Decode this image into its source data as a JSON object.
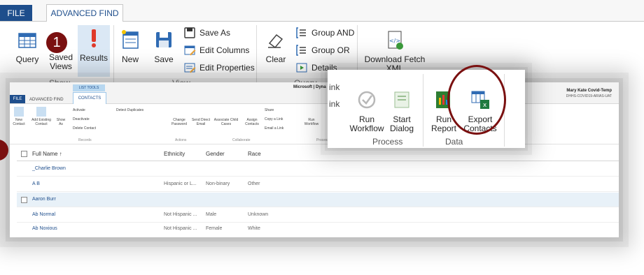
{
  "ribbon": {
    "tabs": {
      "file": "FILE",
      "advanced_find": "ADVANCED FIND"
    },
    "groups": {
      "show": "Show",
      "view": "View",
      "query": "Query"
    },
    "buttons": {
      "query": "Query",
      "saved_views": "Saved Views",
      "results": "Results",
      "new": "New",
      "save": "Save",
      "save_as": "Save As",
      "edit_columns": "Edit Columns",
      "edit_properties": "Edit Properties",
      "clear": "Clear",
      "group_and": "Group AND",
      "group_or": "Group OR",
      "details": "Details",
      "download_fetch_xml": "Download Fetch XML"
    }
  },
  "annotation": {
    "step_number": "1"
  },
  "contacts_screen": {
    "tabs": {
      "file": "FILE",
      "advanced_find": "ADVANCED FIND",
      "list_tools": "LIST TOOLS",
      "contacts": "CONTACTS"
    },
    "brand": "Microsoft | Dyna",
    "user": {
      "name": "Mary Kate Covid-Temp",
      "org": "DHHS-COVID19-ARIAS-UAT"
    },
    "commands": {
      "new_contact": "New Contact",
      "add_existing_contact": "Add Existing Contact",
      "show_as": "Show As",
      "activate": "Activate",
      "deactivate": "Deactivate",
      "delete_contact": "Delete Contact",
      "detect_duplicates": "Detect Duplicates",
      "change_password": "Change Password",
      "send_direct_email": "Send Direct Email",
      "associate_child_cases": "Associate Child Cases",
      "assign_contacts": "Assign Contacts",
      "share": "Share",
      "copy_a_link": "Copy a Link",
      "email_a_link": "Email a Link",
      "run_workflow": "Run Workflow"
    },
    "groups": {
      "records": "Records",
      "actions": "Actions",
      "collaborate": "Collaborate",
      "process": "Process"
    },
    "grid": {
      "columns": [
        "Full Name ↑",
        "Ethnicity",
        "Gender",
        "Race"
      ],
      "rows": [
        {
          "name": "_Charlie Brown",
          "ethnicity": "",
          "gender": "",
          "race": ""
        },
        {
          "name": "A B",
          "ethnicity": "Hispanic or L...",
          "gender": "Non-binary",
          "race": "Other"
        },
        {
          "name": "Aaron Burr",
          "ethnicity": "",
          "gender": "",
          "race": ""
        },
        {
          "name": "Ab Normal",
          "ethnicity": "Not Hispanic ...",
          "gender": "Male",
          "race": "Unknown"
        },
        {
          "name": "Ab Noxious",
          "ethnicity": "Not Hispanic ...",
          "gender": "Female",
          "race": "White"
        }
      ]
    }
  },
  "zoom_panel": {
    "partial_texts": {
      "link": "ink",
      "link2": "ink"
    },
    "buttons": {
      "run_workflow": "Run Workflow",
      "start_dialog": "Start Dialog",
      "run_report": "Run Report",
      "export_contacts": "Export Contacts"
    },
    "groups": {
      "process": "Process",
      "data": "Data"
    }
  },
  "colors": {
    "brand_blue": "#1e4e8c",
    "annotation_red": "#7a1010",
    "selected_row": "#e8f1f8"
  }
}
